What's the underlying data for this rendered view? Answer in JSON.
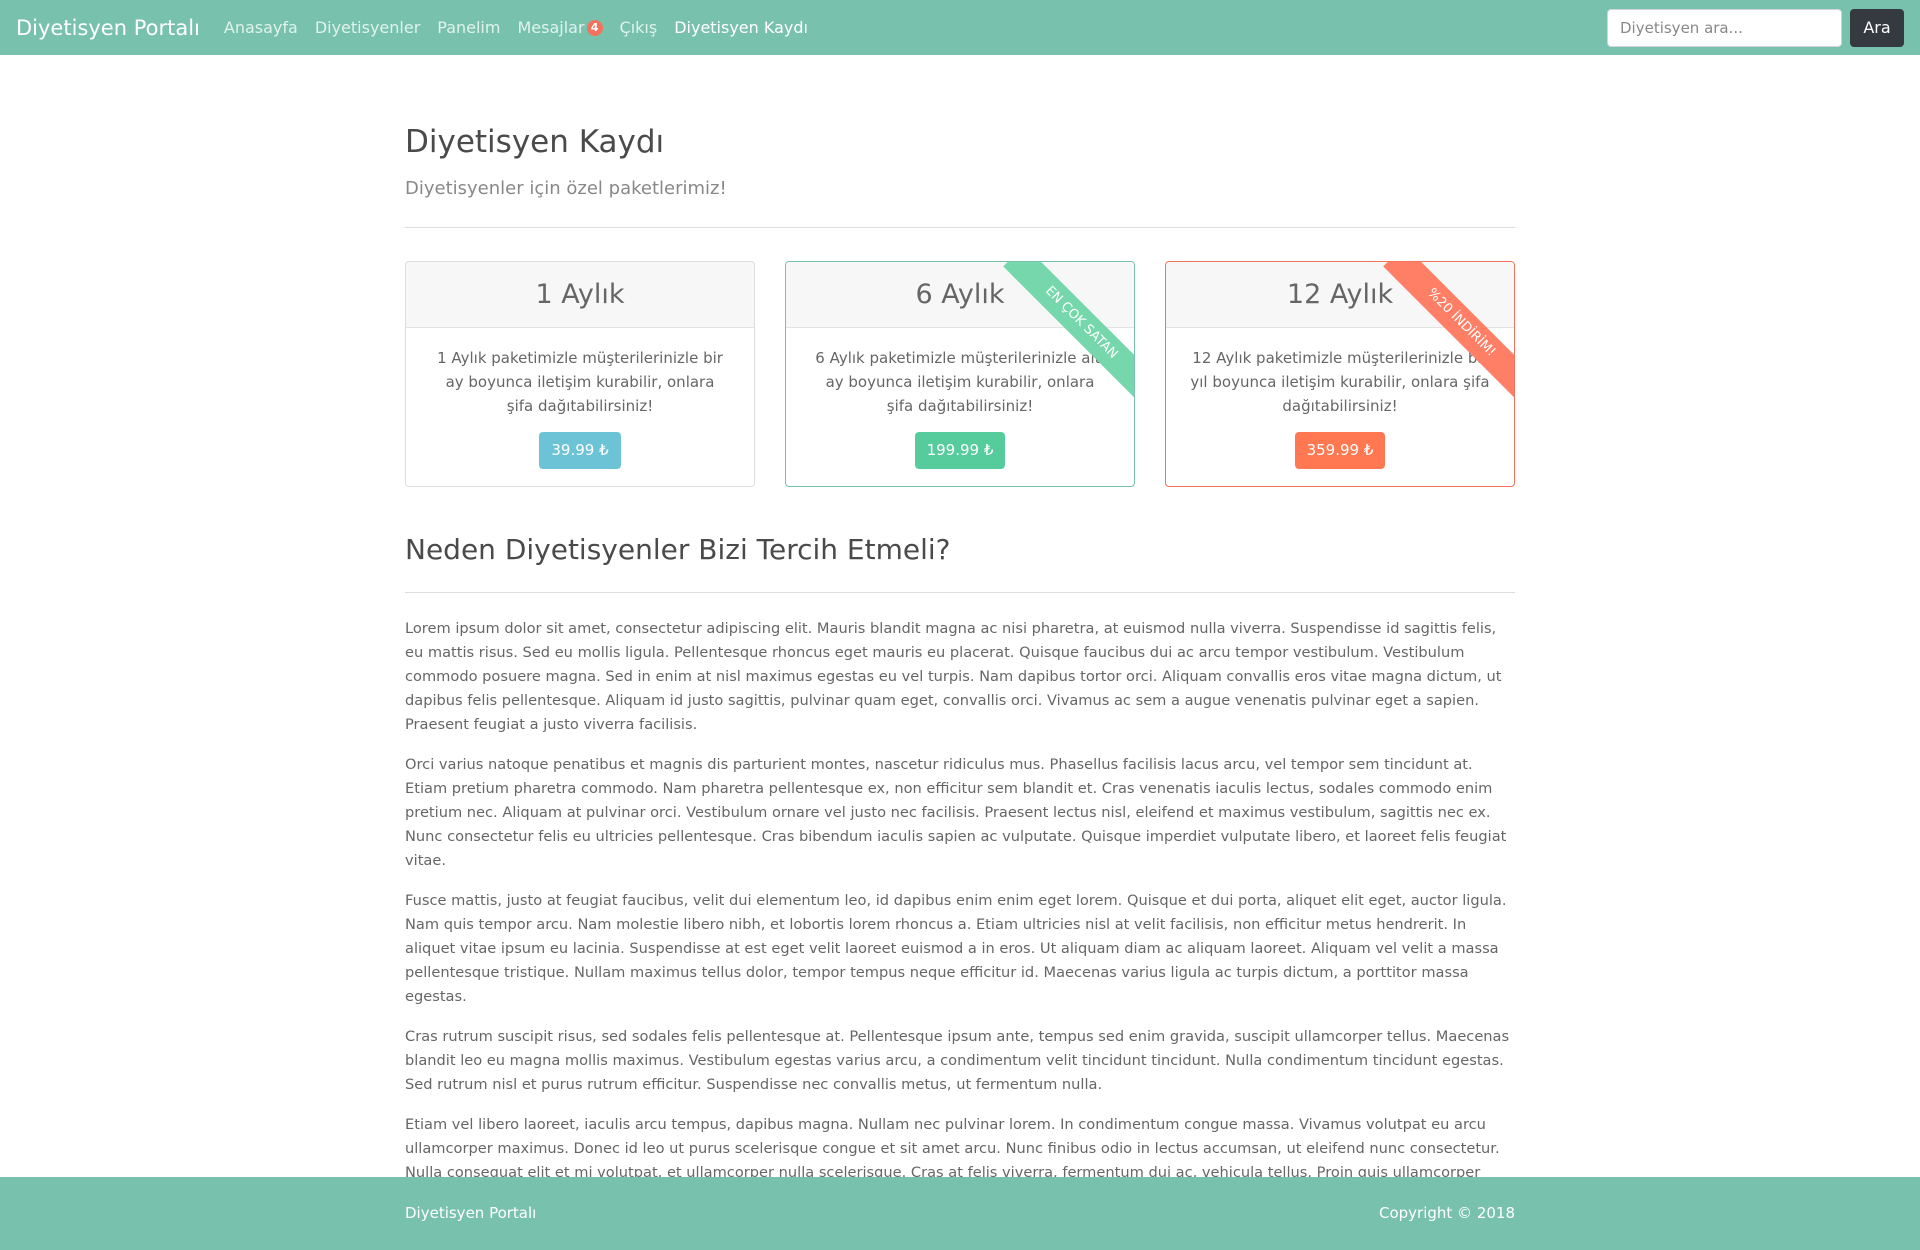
{
  "navbar": {
    "brand": "Diyetisyen Portalı",
    "links": [
      {
        "label": "Anasayfa"
      },
      {
        "label": "Diyetisyenler"
      },
      {
        "label": "Panelim"
      },
      {
        "label": "Mesajlar",
        "badge": "4"
      },
      {
        "label": "Çıkış"
      },
      {
        "label": "Diyetisyen Kaydı"
      }
    ],
    "search_placeholder": "Diyetisyen ara...",
    "search_button": "Ara"
  },
  "page": {
    "title": "Diyetisyen Kaydı",
    "subtitle": "Diyetisyenler için özel paketlerimiz!"
  },
  "packages": [
    {
      "title": "1 Aylık",
      "description": "1 Aylık paketimizle müşterilerinizle bir ay boyunca iletişim kurabilir, onlara şifa dağıtabilirsiniz!",
      "price": "39.99 ₺",
      "ribbon": ""
    },
    {
      "title": "6 Aylık",
      "description": "6 Aylık paketimizle müşterilerinizle altı ay boyunca iletişim kurabilir, onlara şifa dağıtabilirsiniz!",
      "price": "199.99 ₺",
      "ribbon": "EN ÇOK SATAN"
    },
    {
      "title": "12 Aylık",
      "description": "12 Aylık paketimizle müşterilerinizle bir yıl boyunca iletişim kurabilir, onlara şifa dağıtabilirsiniz!",
      "price": "359.99 ₺",
      "ribbon": "%20 İNDİRİM!"
    }
  ],
  "why": {
    "title": "Neden Diyetisyenler Bizi Tercih Etmeli?",
    "paragraphs": [
      "Lorem ipsum dolor sit amet, consectetur adipiscing elit. Mauris blandit magna ac nisi pharetra, at euismod nulla viverra. Suspendisse id sagittis felis, eu mattis risus. Sed eu mollis ligula. Pellentesque rhoncus eget mauris eu placerat. Quisque faucibus dui ac arcu tempor vestibulum. Vestibulum commodo posuere magna. Sed in enim at nisl maximus egestas eu vel turpis. Nam dapibus tortor orci. Aliquam convallis eros vitae magna dictum, ut dapibus felis pellentesque. Aliquam id justo sagittis, pulvinar quam eget, convallis orci. Vivamus ac sem a augue venenatis pulvinar eget a sapien. Praesent feugiat a justo viverra facilisis.",
      "Orci varius natoque penatibus et magnis dis parturient montes, nascetur ridiculus mus. Phasellus facilisis lacus arcu, vel tempor sem tincidunt at. Etiam pretium pharetra commodo. Nam pharetra pellentesque ex, non efficitur sem blandit et. Cras venenatis iaculis lectus, sodales commodo enim pretium nec. Aliquam at pulvinar orci. Vestibulum ornare vel justo nec facilisis. Praesent lectus nisl, eleifend et maximus vestibulum, sagittis nec ex. Nunc consectetur felis eu ultricies pellentesque. Cras bibendum iaculis sapien ac vulputate. Quisque imperdiet vulputate libero, et laoreet felis feugiat vitae.",
      "Fusce mattis, justo at feugiat faucibus, velit dui elementum leo, id dapibus enim enim eget lorem. Quisque et dui porta, aliquet elit eget, auctor ligula. Nam quis tempor arcu. Nam molestie libero nibh, et lobortis lorem rhoncus a. Etiam ultricies nisl at velit facilisis, non efficitur metus hendrerit. In aliquet vitae ipsum eu lacinia. Suspendisse at est eget velit laoreet euismod a in eros. Ut aliquam diam ac aliquam laoreet. Aliquam vel velit a massa pellentesque tristique. Nullam maximus tellus dolor, tempor tempus neque efficitur id. Maecenas varius ligula ac turpis dictum, a porttitor massa egestas.",
      "Cras rutrum suscipit risus, sed sodales felis pellentesque at. Pellentesque ipsum ante, tempus sed enim gravida, suscipit ullamcorper tellus. Maecenas blandit leo eu magna mollis maximus. Vestibulum egestas varius arcu, a condimentum velit tincidunt tincidunt. Nulla condimentum tincidunt egestas. Sed rutrum nisl et purus rutrum efficitur. Suspendisse nec convallis metus, ut fermentum nulla.",
      "Etiam vel libero laoreet, iaculis arcu tempus, dapibus magna. Nullam nec pulvinar lorem. In condimentum congue massa. Vivamus volutpat eu arcu ullamcorper maximus. Donec id leo ut purus scelerisque congue et sit amet arcu. Nunc finibus odio in lectus accumsan, ut eleifend nunc consectetur. Nulla consequat elit et mi volutpat, et ullamcorper nulla scelerisque. Cras at felis viverra, fermentum dui ac, vehicula tellus. Proin quis ullamcorper sem, in varius sem. Phasellus iaculis diam ipsum, sed tempor est bibendum at. Etiam placerat hendrerit ante et accumsan."
    ]
  },
  "footer": {
    "left": "Diyetisyen Portalı",
    "right": "Copyright © 2018"
  },
  "colors": {
    "primary": "#78c2ad",
    "danger": "#f3725d",
    "info": "#6cc3d5",
    "success": "#56cc9d",
    "dark": "#343a40"
  }
}
